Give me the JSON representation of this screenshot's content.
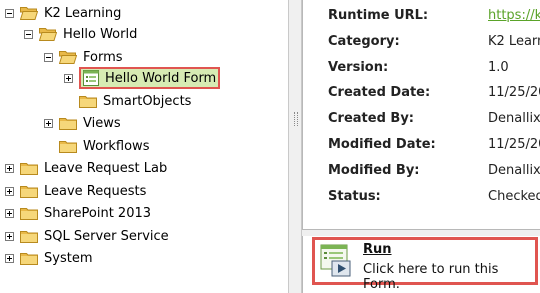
{
  "tree": {
    "root": "K2 Learning",
    "hello_world": "Hello World",
    "forms": "Forms",
    "selected_form": "Hello World Form",
    "smartobjects": "SmartObjects",
    "views": "Views",
    "workflows": "Workflows",
    "leave_request_lab": "Leave Request Lab",
    "leave_requests": "Leave Requests",
    "sharepoint": "SharePoint 2013",
    "sql_server": "SQL Server Service",
    "system": "System"
  },
  "details": {
    "runtime_url_label": "Runtime URL:",
    "runtime_url_value": "https://k",
    "category_label": "Category:",
    "category_value": "K2 Learnir",
    "version_label": "Version:",
    "version_value": "1.0",
    "created_date_label": "Created Date:",
    "created_date_value": "11/25/20",
    "created_by_label": "Created By:",
    "created_by_value": "Denallix",
    "modified_date_label": "Modified Date:",
    "modified_date_value": "11/25/20",
    "modified_by_label": "Modified By:",
    "modified_by_value": "Denallix",
    "status_label": "Status:",
    "status_value": "Checked"
  },
  "actions": {
    "run_title": "Run",
    "run_description": "Click here to run this Form.",
    "run_icon": "run-form-icon"
  },
  "colors": {
    "highlight_border": "#e05550",
    "selection_fill": "#d7ebb3",
    "link_green": "#5aa329",
    "folder_yellow": "#f2c94c"
  }
}
